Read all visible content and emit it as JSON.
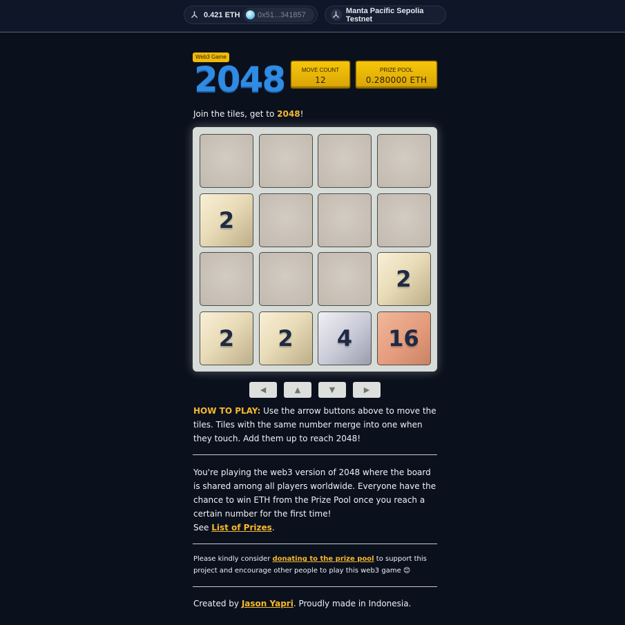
{
  "topbar": {
    "balance": "0.421 ETH",
    "address": "0x51...341857",
    "network": "Manta Pacific Sepolia Testnet"
  },
  "header": {
    "badge": "Web3 Game",
    "title": "2048",
    "move_count_label": "MOVE COUNT",
    "move_count": "12",
    "prize_pool_label": "PRIZE POOL",
    "prize_pool": "0.280000 ETH"
  },
  "tagline": {
    "prefix": "Join the tiles, get to ",
    "target": "2048",
    "suffix": "!"
  },
  "board": {
    "tiles": [
      [
        "",
        "",
        "",
        ""
      ],
      [
        "2",
        "",
        "",
        ""
      ],
      [
        "",
        "",
        "",
        "2"
      ],
      [
        "2",
        "2",
        "4",
        "16"
      ]
    ]
  },
  "controls": {
    "left": "◀",
    "up": "▲",
    "down": "▼",
    "right": "▶"
  },
  "how_to": {
    "label": "HOW TO PLAY:",
    "text": " Use the arrow buttons above to move the tiles. Tiles with the same number merge into one when they touch. Add them up to reach 2048!"
  },
  "about": {
    "text": "You're playing the web3 version of 2048 where the board is shared among all players worldwide. Everyone have the chance to win ETH from the Prize Pool once you reach a certain number for the first time!",
    "see": "See ",
    "prizes_link": "List of Prizes",
    "end": "."
  },
  "donate": {
    "prefix": "Please kindly consider ",
    "link": "donating to the prize pool",
    "suffix": " to support this project and encourage other people to play this web3 game ",
    "emoji": "😊"
  },
  "footer": {
    "prefix": "Created by ",
    "author": "Jason Yapri",
    "suffix": ". Proudly made in Indonesia."
  },
  "colors": {
    "accent": "#f5b82e",
    "title_blue": "#2f8be3",
    "background": "#0b101d"
  }
}
